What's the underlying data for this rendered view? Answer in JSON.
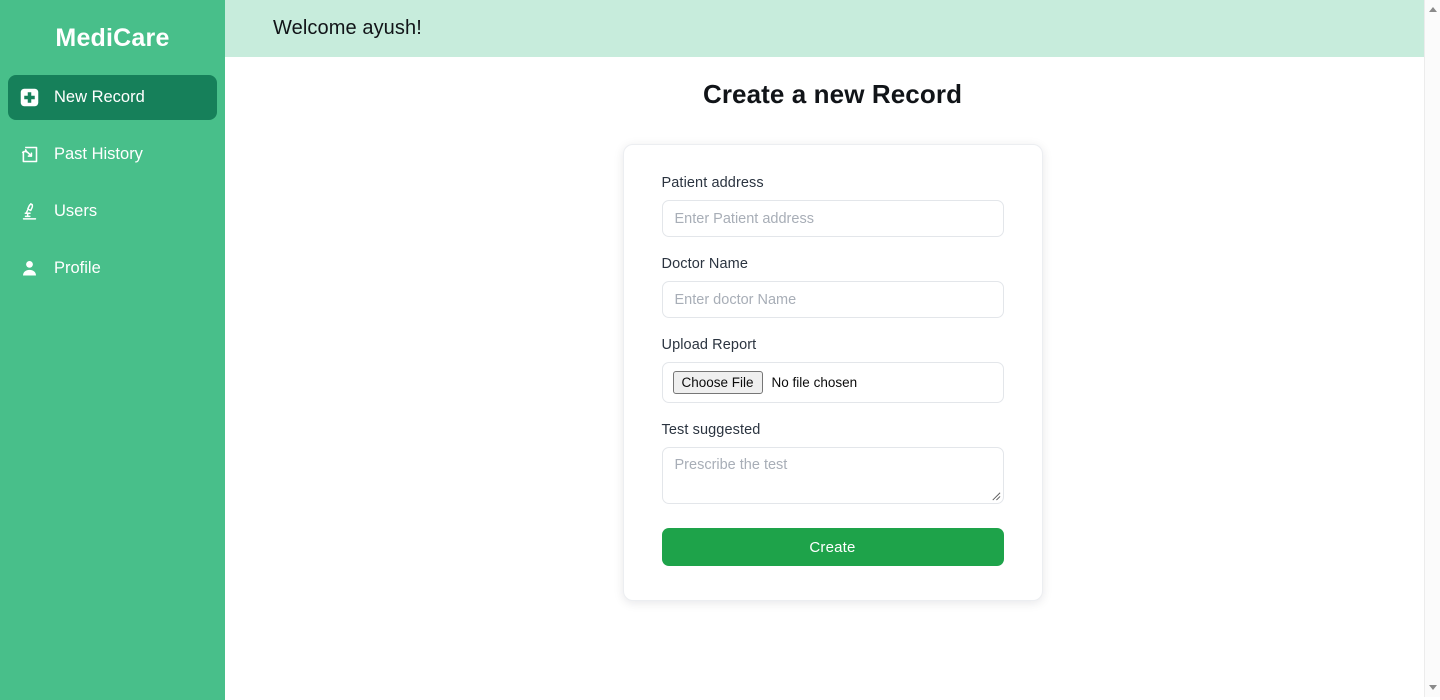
{
  "brand": {
    "name": "MediCare"
  },
  "sidebar": {
    "items": [
      {
        "label": "New Record",
        "icon": "medical-cross-icon",
        "active": true
      },
      {
        "label": "Past History",
        "icon": "history-document-icon",
        "active": false
      },
      {
        "label": "Users",
        "icon": "microscope-icon",
        "active": false
      },
      {
        "label": "Profile",
        "icon": "person-icon",
        "active": false
      }
    ]
  },
  "topbar": {
    "welcome": "Welcome ayush!"
  },
  "page": {
    "title": "Create a new Record"
  },
  "form": {
    "fields": {
      "patient_address": {
        "label": "Patient address",
        "placeholder": "Enter Patient address",
        "value": ""
      },
      "doctor_name": {
        "label": "Doctor Name",
        "placeholder": "Enter doctor Name",
        "value": ""
      },
      "upload_report": {
        "label": "Upload Report",
        "button": "Choose File",
        "status": "No file chosen"
      },
      "test_suggested": {
        "label": "Test suggested",
        "placeholder": "Prescribe the test",
        "value": ""
      }
    },
    "submit_label": "Create"
  },
  "colors": {
    "sidebar_green": "#48bf8a",
    "active_green": "#16805a",
    "topbar_mint": "#c7ecdc",
    "button_green": "#1ea34a",
    "text_dark": "#111418",
    "placeholder_gray": "#a8aeb7"
  },
  "scrollbar": {
    "up_icon": "chevron-up-icon",
    "down_icon": "chevron-down-icon"
  }
}
